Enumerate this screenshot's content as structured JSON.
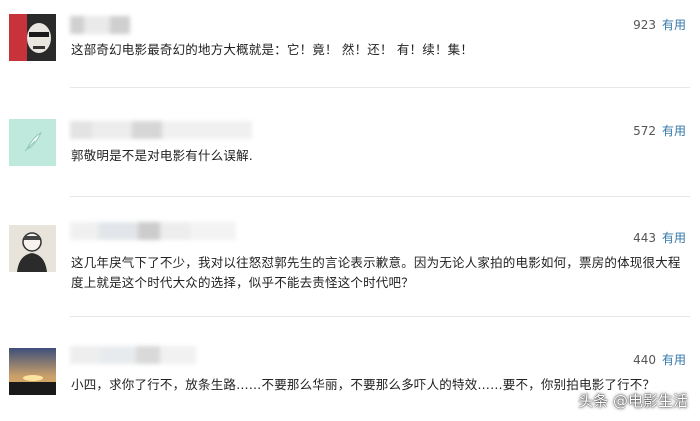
{
  "comments": [
    {
      "votes": "923",
      "vote_label": "有用",
      "text": "这部奇幻电影最奇幻的地方大概就是：它！竟！ 然！还！ 有！续！集！",
      "avatar_icon": "masked-portrait-avatar"
    },
    {
      "votes": "572",
      "vote_label": "有用",
      "text": "郭敬明是不是对电影有什么误解.",
      "avatar_icon": "feather-avatar"
    },
    {
      "votes": "443",
      "vote_label": "有用",
      "text": "这几年戾气下了不少，我对以往怒怼郭先生的言论表示歉意。因为无论人家拍的电影如何，票房的体现很大程度上就是这个时代大众的选择，似乎不能去责怪这个时代吧？",
      "avatar_icon": "sketch-person-avatar"
    },
    {
      "votes": "440",
      "vote_label": "有用",
      "text": "小四，求你了行不，放条生路……不要那么华丽，不要那么多吓人的特效……要不，你别拍电影了行不？",
      "avatar_icon": "sunset-landscape-avatar"
    }
  ],
  "watermark": "头条 @电影生活"
}
